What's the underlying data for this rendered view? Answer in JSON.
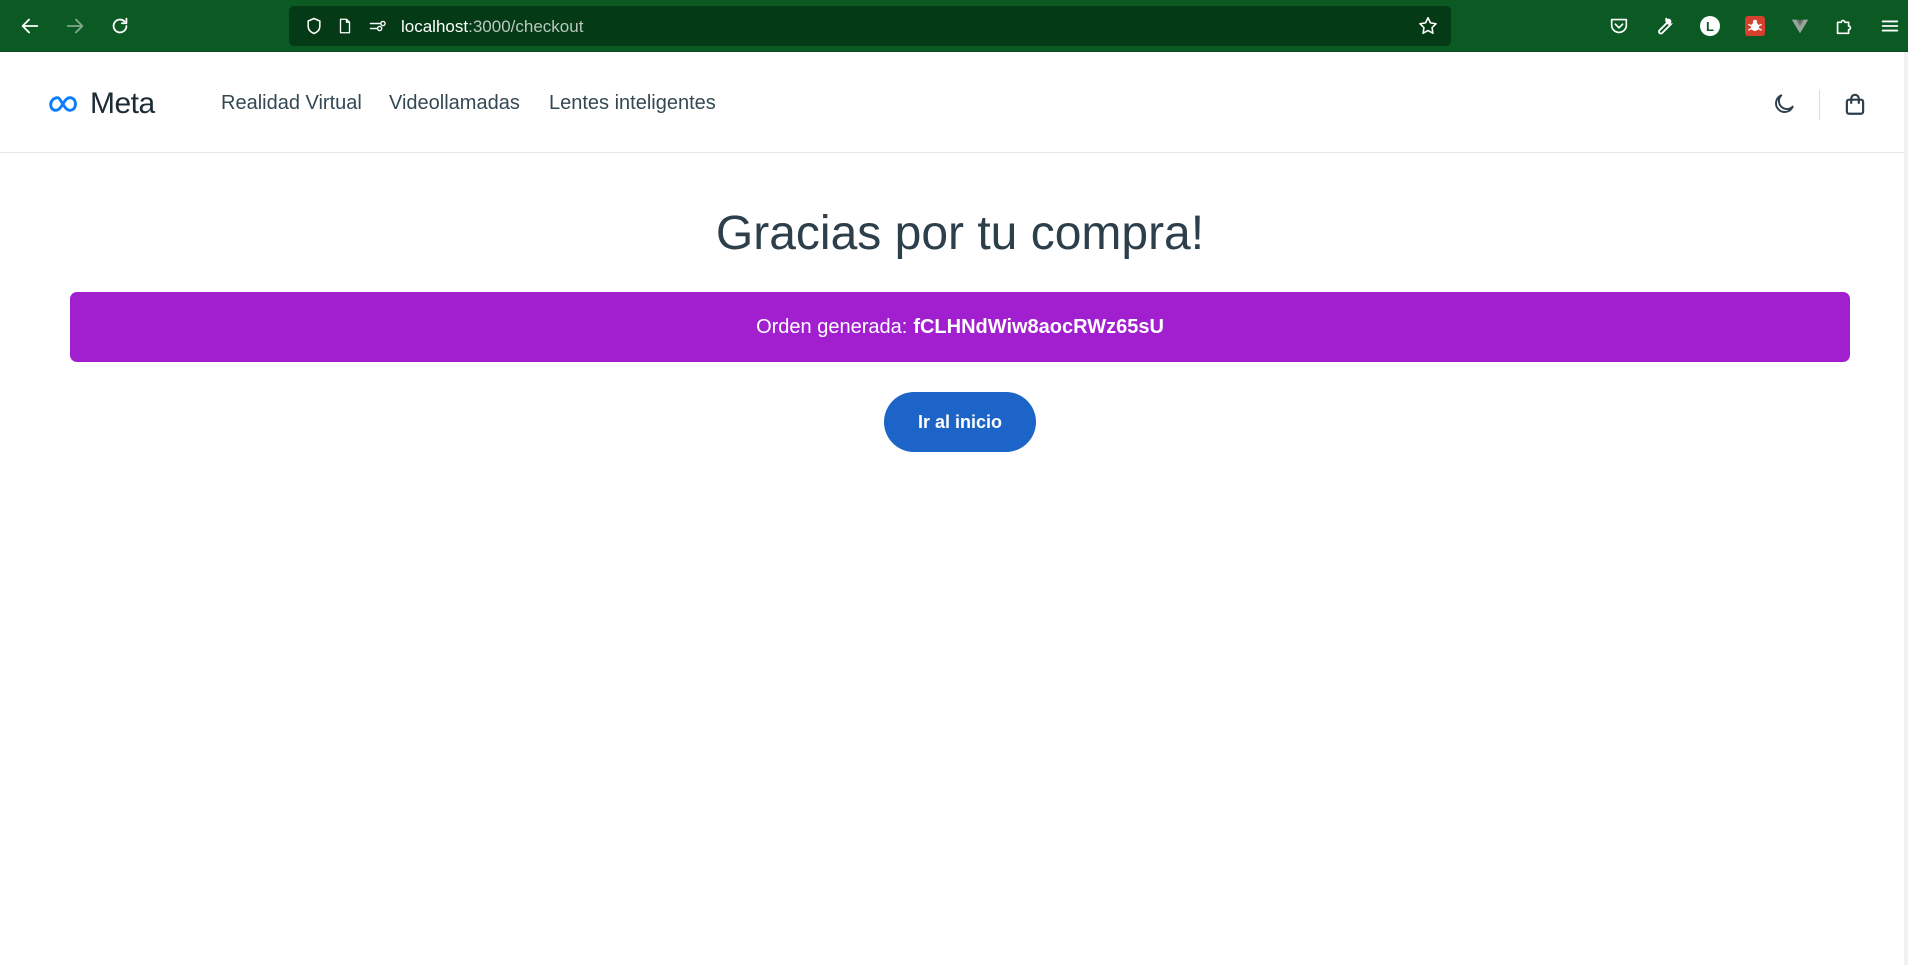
{
  "browser": {
    "url_host": "localhost",
    "url_path": ":3000/checkout",
    "avatar_letter": "L",
    "accent_color": "#0b5a24"
  },
  "header": {
    "logo_text": "Meta",
    "nav": [
      {
        "label": "Realidad Virtual"
      },
      {
        "label": "Videollamadas"
      },
      {
        "label": "Lentes inteligentes"
      }
    ]
  },
  "main": {
    "title": "Gracias por tu compra!",
    "order_label": "Orden generada:",
    "order_id": "fCLHNdWiw8aocRWz65sU",
    "home_button_label": "Ir al inicio",
    "banner_color": "#a21fd0",
    "button_color": "#1d64c8"
  },
  "icons": {
    "back": "arrow-left-icon",
    "forward": "arrow-right-icon",
    "reload": "reload-icon",
    "shield": "shield-icon",
    "page": "page-icon",
    "permissions": "permissions-icon",
    "bookmark": "star-icon",
    "pocket": "pocket-icon",
    "tools": "wrench-icon",
    "extensions": "puzzle-icon",
    "menu": "hamburger-icon",
    "theme": "moon-icon",
    "cart": "shopping-bag-icon"
  }
}
